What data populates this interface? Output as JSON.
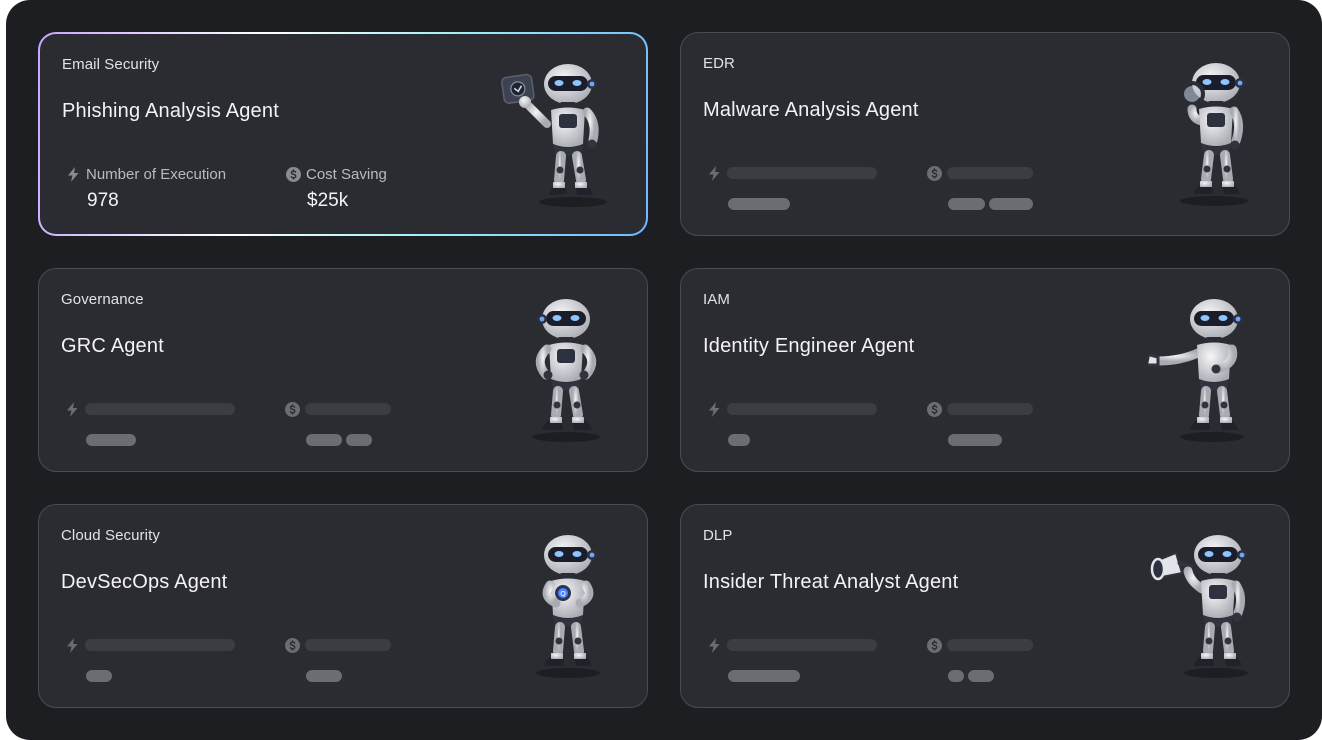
{
  "cards": [
    {
      "category": "Email Security",
      "title": "Phishing Analysis Agent",
      "execution_label": "Number of Execution",
      "execution_value": "978",
      "saving_label": "Cost Saving",
      "saving_value": "$25k",
      "robot_pose": "holding-shield"
    },
    {
      "category": "EDR",
      "title": "Malware Analysis Agent",
      "robot_pose": "magnifying-glass"
    },
    {
      "category": "Governance",
      "title": "GRC Agent",
      "robot_pose": "hands-on-hips"
    },
    {
      "category": "IAM",
      "title": "Identity Engineer Agent",
      "robot_pose": "presenting"
    },
    {
      "category": "Cloud Security",
      "title": "DevSecOps Agent",
      "robot_pose": "holding-badge"
    },
    {
      "category": "DLP",
      "title": "Insider Threat Analyst Agent",
      "robot_pose": "megaphone"
    }
  ],
  "icons": {
    "execution": "lightning-icon",
    "saving": "dollar-coin-icon"
  },
  "colors": {
    "background": "#1d1e22",
    "card": "#2b2c31",
    "card_border": "#4a4b51",
    "active_gradient_start": "#c6a5ff",
    "active_gradient_end": "#6fb8ff",
    "skeleton_line": "#3c3d42",
    "skeleton_pill": "#6c6d72"
  }
}
